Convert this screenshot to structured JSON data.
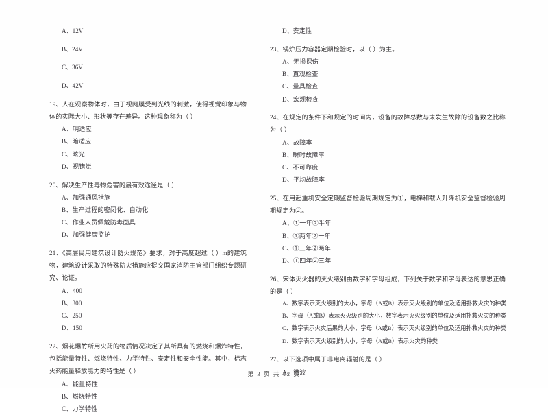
{
  "document": {
    "page_footer": "第 3 页 共 12 页",
    "page_number": "3",
    "total_pages": "12"
  },
  "left_column": {
    "orphan_options": [
      "A、12V",
      "B、24V",
      "C、36V",
      "D、42V"
    ],
    "questions": [
      {
        "number": "19",
        "stem": "19、人在观察物体时，由于视网膜受到光线的刺激，使得视觉印象与物体的实际大小、形状等存在差异。这种现象称为（    ）",
        "options": [
          "A、明适应",
          "B、暗适应",
          "C、眩光",
          "D、视错觉"
        ]
      },
      {
        "number": "20",
        "stem": "20、解决生产性毒物危害的最有效途径是（    ）",
        "options": [
          "A、加强通风措施",
          "B、生产过程的密闭化、自动化",
          "C、作业人员佩戴防毒面具",
          "D、加强健康监护"
        ]
      },
      {
        "number": "21",
        "stem": "21、《高层民用建筑设计防火规范》要求，对于高度超过（    ）m的建筑物，建筑设计采取的特殊防火措施应提交国家消防主管部门组织专题研究、论证。",
        "options": [
          "A、400",
          "B、300",
          "C、250",
          "D、150"
        ]
      },
      {
        "number": "22",
        "stem": "22、烟花爆竹所用火药的物质情况决定了其所具有的燃烧和爆炸特性，包括能量特性、燃烧特性、力学特性、安定性和安全性能。其中，标志火药能量释放能力的特性是（    ）",
        "options": [
          "A、能量特性",
          "B、燃烧特性",
          "C、力学特性"
        ]
      }
    ]
  },
  "right_column": {
    "orphan_options": [
      "D、安定性"
    ],
    "questions": [
      {
        "number": "23",
        "stem": "23、锅炉压力容器定期检验时，以（    ）为主。",
        "options": [
          "A、无损探伤",
          "B、直观检查",
          "C、量具检查",
          "D、宏观检查"
        ]
      },
      {
        "number": "24",
        "stem": "24、在规定的条件下和规定的时间内，设备的故障总数与未发生故障的设备数之比称为（    ）",
        "options": [
          "A、故障率",
          "B、瞬时故障率",
          "C、不可靠度",
          "D、平均故障率"
        ]
      },
      {
        "number": "25",
        "stem": "25、在用起重机安全定期监督检验周期规定为①，电梯和载人升降机安全监督检验周期规定为②。",
        "options": [
          "A、①一年②半年",
          "B、①两年②一年",
          "C、①三年②两年",
          "D、①四年②三年"
        ]
      },
      {
        "number": "26",
        "stem": "26、宋体灭火器的灭火级别由数字和字母组成，下列关于数字和字母表达的意思正确的是（    ）",
        "options": [
          "A、数字表示灭火级别的大小，字母（A或B）表示灭火级别的单位及适用扑救火灾的种类",
          "B、字母（A或B）表示灭火级别的大小，数字表示灭火级别的单位及适用扑救火灾的种类",
          "C、数字表示火灾后果的大小，字母（A或B）表示灭火级别的单位及适用扑救火灾的种类",
          "D、数字表示灭火级别的大小，字母（A或B）表示火灾的种类"
        ]
      },
      {
        "number": "27",
        "stem": "27、以下选项中属于非电离辐射的是（    ）",
        "options": [
          "A、微波"
        ]
      }
    ]
  }
}
